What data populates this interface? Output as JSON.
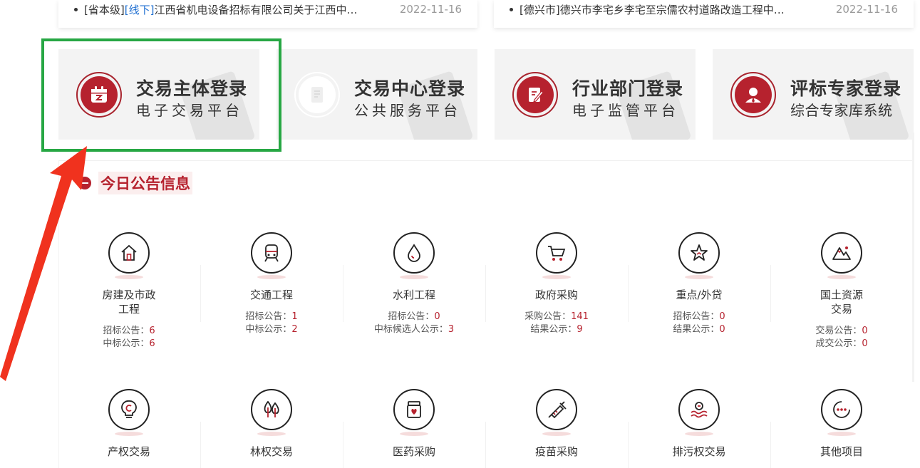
{
  "news": {
    "left": {
      "level": "[省本级]",
      "tag": "[线下]",
      "title": "江西省机电设备招标有限公司关于江西中…",
      "date": "2022-11-16"
    },
    "right": {
      "level": "[德兴市]",
      "title": "德兴市李宅乡李宅至宗儒农村道路改造工程中…",
      "date": "2022-11-16"
    }
  },
  "tiles": [
    {
      "title": "交易主体登录",
      "subtitle": "电子交易平台",
      "icon": "calendar-icon"
    },
    {
      "title": "交易中心登录",
      "subtitle": "公共服务平台",
      "icon": "document-icon"
    },
    {
      "title": "行业部门登录",
      "subtitle": "电子监管平台",
      "icon": "edit-icon"
    },
    {
      "title": "评标专家登录",
      "subtitle": "综合专家库系统",
      "icon": "expert-icon"
    }
  ],
  "section": {
    "title": "今日公告信息"
  },
  "categories": [
    {
      "name_line1": "房建及市政",
      "name_line2": "工程",
      "icon": "house-icon",
      "stat1_label": "招标公告：",
      "stat1_value": "6",
      "stat2_label": "中标公示：",
      "stat2_value": "6"
    },
    {
      "name_line1": "交通工程",
      "name_line2": "",
      "icon": "train-icon",
      "stat1_label": "招标公告：",
      "stat1_value": "1",
      "stat2_label": "中标公示：",
      "stat2_value": "2"
    },
    {
      "name_line1": "水利工程",
      "name_line2": "",
      "icon": "water-drop-icon",
      "stat1_label": "招标公告：",
      "stat1_value": "0",
      "stat2_label": "中标候选人公示：",
      "stat2_value": "3"
    },
    {
      "name_line1": "政府采购",
      "name_line2": "",
      "icon": "cart-icon",
      "stat1_label": "采购公告：",
      "stat1_value": "141",
      "stat2_label": "结果公示：",
      "stat2_value": "9"
    },
    {
      "name_line1": "重点/外贷",
      "name_line2": "",
      "icon": "star-icon",
      "stat1_label": "招标公告：",
      "stat1_value": "0",
      "stat2_label": "结果公示：",
      "stat2_value": "0"
    },
    {
      "name_line1": "国土资源",
      "name_line2": "交易",
      "icon": "mountain-icon",
      "stat1_label": "交易公告：",
      "stat1_value": "0",
      "stat2_label": "成交公示：",
      "stat2_value": "0"
    },
    {
      "name_line1": "产权交易",
      "name_line2": "",
      "icon": "bulb-copyright-icon"
    },
    {
      "name_line1": "林权交易",
      "name_line2": "",
      "icon": "tree-icon"
    },
    {
      "name_line1": "医药采购",
      "name_line2": "",
      "icon": "medicine-icon"
    },
    {
      "name_line1": "疫苗采购",
      "name_line2": "",
      "icon": "syringe-icon"
    },
    {
      "name_line1": "排污权交易",
      "name_line2": "",
      "icon": "emission-icon"
    },
    {
      "name_line1": "其他项目",
      "name_line2": "",
      "icon": "more-icon"
    }
  ],
  "colors": {
    "accent": "#b6222e",
    "highlight": "#27a744",
    "arrow": "#f0321e",
    "tile_bg": "#f3f3f3"
  }
}
